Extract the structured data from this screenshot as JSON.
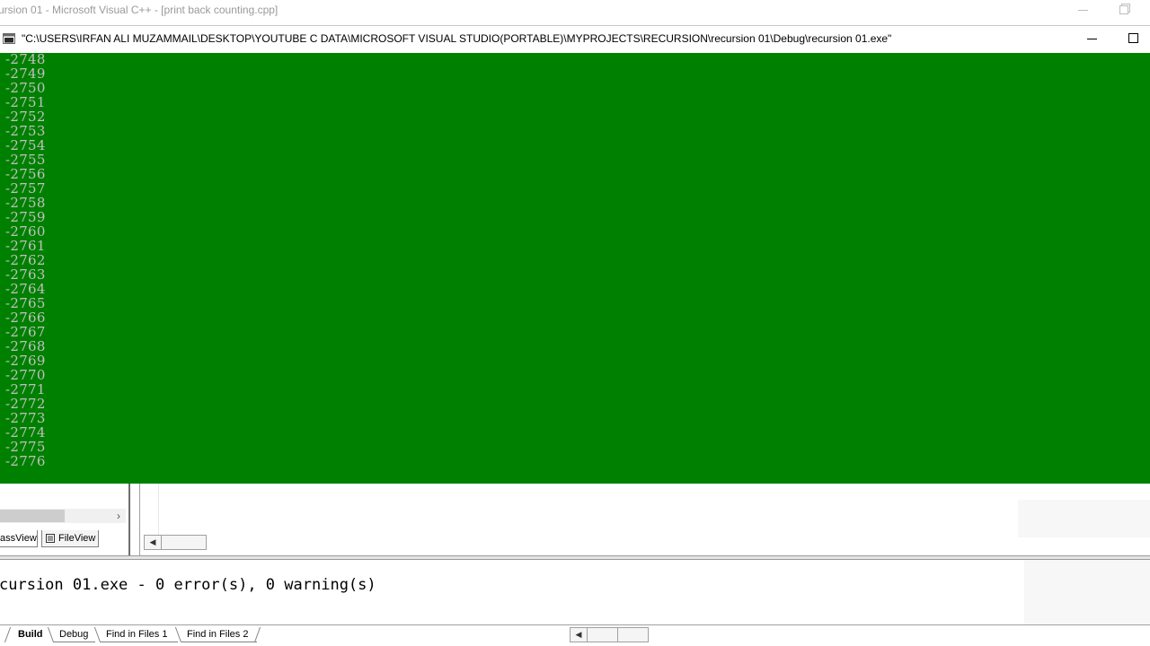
{
  "ide": {
    "title": "ursion 01 - Microsoft Visual C++ - [print back counting.cpp]"
  },
  "console": {
    "title": "\"C:\\USERS\\IRFAN ALI MUZAMMAIL\\DESKTOP\\YOUTUBE C DATA\\MICROSOFT VISUAL STUDIO(PORTABLE)\\MYPROJECTS\\RECURSION\\recursion 01\\Debug\\recursion 01.exe\"",
    "background_color": "#008000",
    "text_color": "#c0c0c0",
    "lines": [
      "-2748",
      "-2749",
      "-2750",
      "-2751",
      "-2752",
      "-2753",
      "-2754",
      "-2755",
      "-2756",
      "-2757",
      "-2758",
      "-2759",
      "-2760",
      "-2761",
      "-2762",
      "-2763",
      "-2764",
      "-2765",
      "-2766",
      "-2767",
      "-2768",
      "-2769",
      "-2770",
      "-2771",
      "-2772",
      "-2773",
      "-2774",
      "-2775",
      "-2776"
    ]
  },
  "workspace": {
    "tabs": {
      "classview": "assView",
      "fileview": "FileView"
    }
  },
  "output": {
    "message": "cursion 01.exe - 0 error(s), 0 warning(s)",
    "tabs": {
      "build": "Build",
      "debug": "Debug",
      "find_in_files_1": "Find in Files 1",
      "find_in_files_2": "Find in Files 2"
    }
  },
  "icons": {
    "console_app": "console-window-icon",
    "fileview": "document-icon",
    "minimize": "minimize-icon",
    "maximize": "maximize-icon",
    "restore": "restore-icon"
  }
}
